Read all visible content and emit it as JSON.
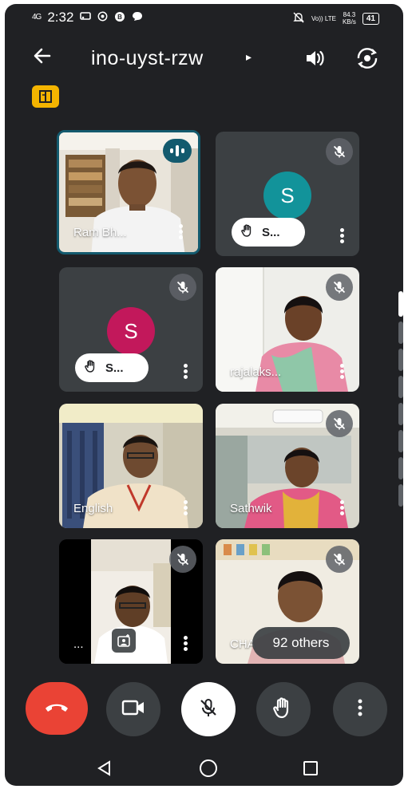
{
  "status_bar": {
    "network": "4G",
    "time": "2:32",
    "speed": "84.3",
    "speed_unit": "KB/s",
    "volte": "Vo)) LTE",
    "battery": "41",
    "notification_icons": [
      "cast-icon",
      "whatsapp-icon",
      "whatsapp-business-icon",
      "chat-icon"
    ],
    "right_icons": [
      "mute-notifications-icon"
    ]
  },
  "app_bar": {
    "back_icon": "back-arrow-icon",
    "meeting_code": "ino-uyst-rzw",
    "caret": "▸",
    "speaker_icon": "speaker-icon",
    "flip_icon": "flip-camera-icon"
  },
  "host_badge_icon": "host-controls-icon",
  "tiles": [
    {
      "name": "Ram Bh...",
      "state": "speaking",
      "icon": "audio-level-icon"
    },
    {
      "name": "S...",
      "state": "hand-raised",
      "avatar": "S",
      "avatar_color": "#12939a",
      "icon": "mic-off-icon"
    },
    {
      "name": "S...",
      "state": "hand-raised",
      "avatar": "S",
      "avatar_color": "#c2185b",
      "icon": "mic-off-icon"
    },
    {
      "name": "rajalaks...",
      "state": "muted",
      "icon": "mic-off-icon"
    },
    {
      "name": "English",
      "state": "video",
      "icon": ""
    },
    {
      "name": "Sathwik",
      "state": "muted",
      "icon": "mic-off-icon"
    },
    {
      "name": "...",
      "state": "muted",
      "icon": "mic-off-icon"
    },
    {
      "name": "CHA",
      "state": "muted",
      "icon": "mic-off-icon"
    }
  ],
  "others_pill": "92 others",
  "controls": {
    "end_call_icon": "end-call-icon",
    "camera_icon": "camera-icon",
    "mic_icon": "mic-off-icon",
    "hand_icon": "raise-hand-icon",
    "more_icon": "more-vert-icon"
  },
  "navigation": {
    "back": "◁",
    "home": "○",
    "recents": "□"
  }
}
